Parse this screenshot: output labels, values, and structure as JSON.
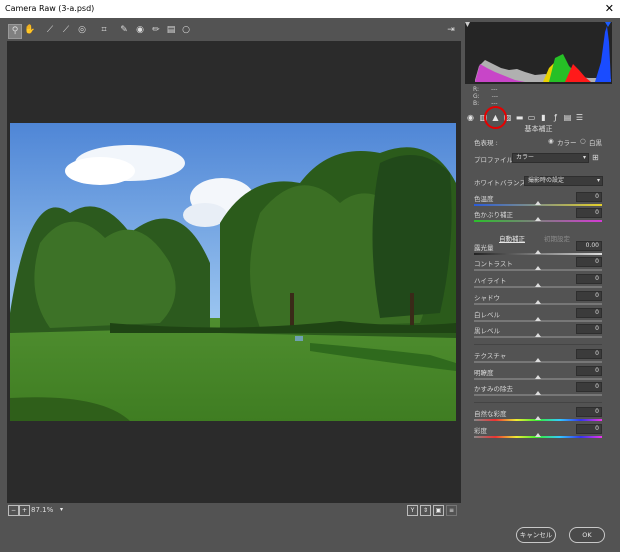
{
  "window": {
    "title": "Camera Raw (3-a.psd)",
    "close_glyph": "✕"
  },
  "statusbar": {
    "zoom": "87.1%"
  },
  "rgb": {
    "r_label": "R:",
    "g_label": "G:",
    "b_label": "B:",
    "r_value": "---",
    "g_value": "---",
    "b_value": "---"
  },
  "panel": {
    "title": "基本補正",
    "treatment_label": "色表現 :",
    "treatment_color": "カラー",
    "treatment_bw": "白黒",
    "profile_label": "プロファイル :",
    "profile_value": "カラー",
    "wb_label": "ホワイトバランス :",
    "wb_value": "撮影時の設定",
    "temp_label": "色温度",
    "temp_value": "0",
    "tint_label": "色かぶり補正",
    "tint_value": "0",
    "auto_label": "自動補正",
    "default_label": "初期設定",
    "sliders": [
      {
        "label": "露光量",
        "value": "0.00"
      },
      {
        "label": "コントラスト",
        "value": "0"
      },
      {
        "label": "ハイライト",
        "value": "0"
      },
      {
        "label": "シャドウ",
        "value": "0"
      },
      {
        "label": "白レベル",
        "value": "0"
      },
      {
        "label": "黒レベル",
        "value": "0"
      }
    ],
    "presence": [
      {
        "label": "テクスチャ",
        "value": "0"
      },
      {
        "label": "明瞭度",
        "value": "0"
      },
      {
        "label": "かすみの除去",
        "value": "0"
      }
    ],
    "vib": [
      {
        "label": "自然な彩度",
        "value": "0"
      },
      {
        "label": "彩度",
        "value": "0"
      }
    ]
  },
  "buttons": {
    "cancel": "キャンセル",
    "ok": "OK"
  },
  "colors": {
    "accent_red": "#e40000",
    "bg": "#535353",
    "viewer": "#2b2b2b"
  }
}
